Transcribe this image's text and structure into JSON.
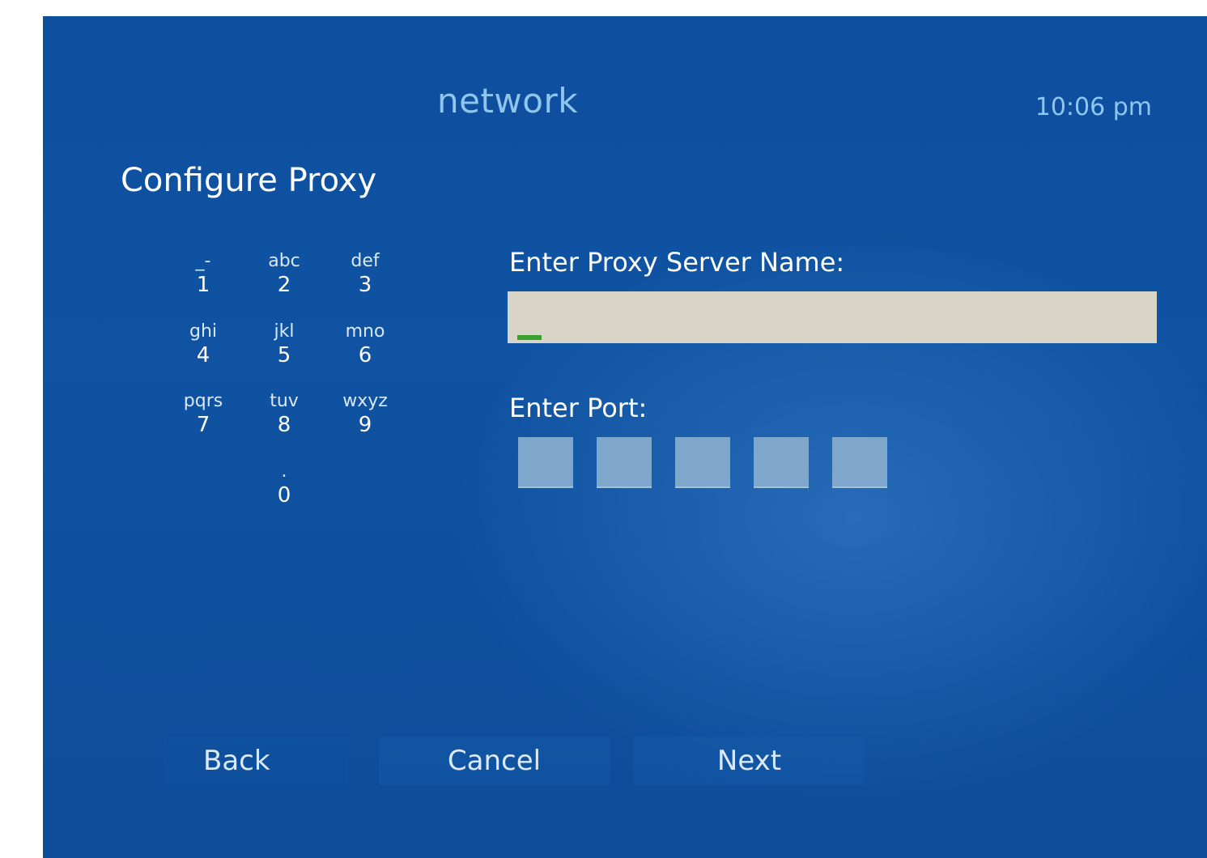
{
  "header": {
    "app_title": "network",
    "time": "10:06 pm"
  },
  "page": {
    "title": "Configure Proxy"
  },
  "keypad": {
    "keys": [
      {
        "letters": "_-",
        "digit": "1"
      },
      {
        "letters": "abc",
        "digit": "2"
      },
      {
        "letters": "def",
        "digit": "3"
      },
      {
        "letters": "ghi",
        "digit": "4"
      },
      {
        "letters": "jkl",
        "digit": "5"
      },
      {
        "letters": "mno",
        "digit": "6"
      },
      {
        "letters": "pqrs",
        "digit": "7"
      },
      {
        "letters": "tuv",
        "digit": "8"
      },
      {
        "letters": "wxyz",
        "digit": "9"
      },
      {
        "letters": ".",
        "digit": "0"
      }
    ]
  },
  "form": {
    "server_label": "Enter Proxy Server Name:",
    "server_value": "",
    "port_label": "Enter Port:",
    "port_digits": [
      "",
      "",
      "",
      "",
      ""
    ]
  },
  "buttons": {
    "back": "Back",
    "cancel": "Cancel",
    "next": "Next"
  },
  "colors": {
    "background": "#0f53a2",
    "title_accent": "#8ec6ee",
    "input_fill": "#d9d5c6",
    "cursor": "#3aa12c",
    "port_box": "#7fa7cb"
  }
}
